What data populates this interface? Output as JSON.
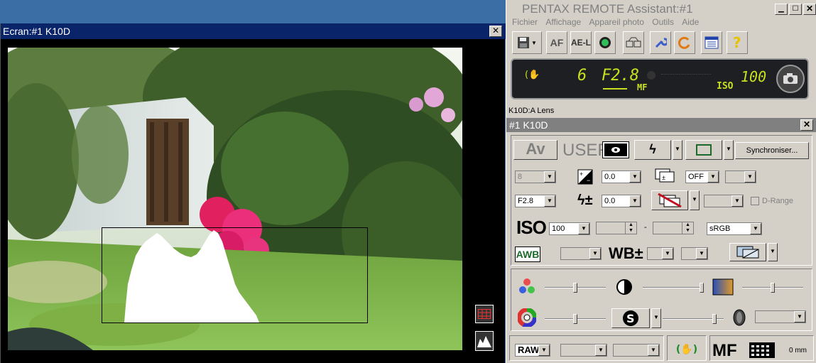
{
  "preview": {
    "title": "Ecran:#1 K10D",
    "close": "✕"
  },
  "remote": {
    "title": "PENTAX REMOTE Assistant:#1",
    "menu": [
      "Fichier",
      "Affichage",
      "Appareil photo",
      "Outils",
      "Aide"
    ],
    "toolbar": {
      "af": "AF",
      "ael": "AE-L"
    },
    "lcd": {
      "shutter": "6",
      "aperture": "F2.8",
      "mf": "MF",
      "iso_label": "ISO",
      "iso_value": "100"
    },
    "lens": "K10D:A Lens",
    "camera_title": "#1 K10D",
    "mode": {
      "av": "Av",
      "user": "USER"
    },
    "sync_button": "Synchroniser...",
    "controls": {
      "shutter_speed": "8",
      "ev_comp": "0.0",
      "drive": "OFF",
      "aperture": "F2.8",
      "flash_comp": "0.0",
      "d_range": "D-Range",
      "iso_label": "ISO",
      "iso_value": "100",
      "color_space": "sRGB",
      "awb": "AWB",
      "wb_label": "WB±"
    },
    "bottom": {
      "format": "RAW",
      "mf": "MF",
      "distance": "0 mm"
    }
  },
  "colors": {
    "titlebar_active": "#0a246a",
    "titlebar_inactive": "#808080",
    "lcd_green": "#c8e021",
    "window_face": "#d4d0c8",
    "desktop": "#3a6ea5"
  }
}
